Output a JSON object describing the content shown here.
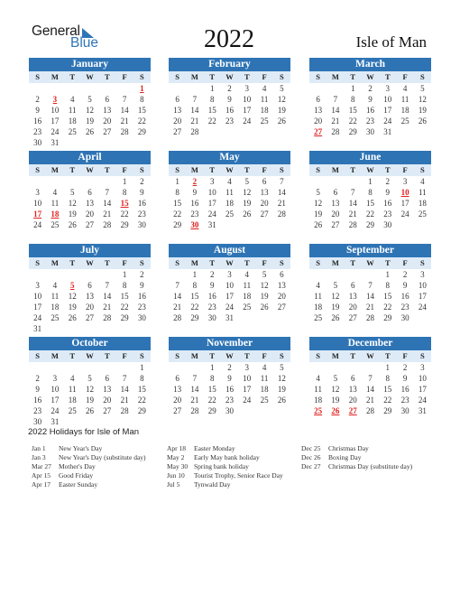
{
  "logo": {
    "line1": "General",
    "line2": "Blue"
  },
  "header": {
    "year": "2022",
    "region": "Isle of Man"
  },
  "weekday_labels": [
    "S",
    "M",
    "T",
    "W",
    "T",
    "F",
    "S"
  ],
  "colors": {
    "header_blue": "#2E74B5",
    "weekday_row": "#DEEBF7",
    "holiday_red": "#E0201E",
    "logo_blue": "#2E75B6"
  },
  "months": [
    {
      "name": "January",
      "holidays": [
        1,
        3
      ],
      "weeks": [
        [
          null,
          null,
          null,
          null,
          null,
          null,
          1
        ],
        [
          2,
          3,
          4,
          5,
          6,
          7,
          8
        ],
        [
          9,
          10,
          11,
          12,
          13,
          14,
          15
        ],
        [
          16,
          17,
          18,
          19,
          20,
          21,
          22
        ],
        [
          23,
          24,
          25,
          26,
          27,
          28,
          29
        ],
        [
          30,
          31,
          null,
          null,
          null,
          null,
          null
        ]
      ]
    },
    {
      "name": "February",
      "holidays": [],
      "weeks": [
        [
          null,
          null,
          1,
          2,
          3,
          4,
          5
        ],
        [
          6,
          7,
          8,
          9,
          10,
          11,
          12
        ],
        [
          13,
          14,
          15,
          16,
          17,
          18,
          19
        ],
        [
          20,
          21,
          22,
          23,
          24,
          25,
          26
        ],
        [
          27,
          28,
          null,
          null,
          null,
          null,
          null
        ]
      ]
    },
    {
      "name": "March",
      "holidays": [
        27
      ],
      "weeks": [
        [
          null,
          null,
          1,
          2,
          3,
          4,
          5
        ],
        [
          6,
          7,
          8,
          9,
          10,
          11,
          12
        ],
        [
          13,
          14,
          15,
          16,
          17,
          18,
          19
        ],
        [
          20,
          21,
          22,
          23,
          24,
          25,
          26
        ],
        [
          27,
          28,
          29,
          30,
          31,
          null,
          null
        ]
      ]
    },
    {
      "name": "April",
      "holidays": [
        15,
        17,
        18
      ],
      "weeks": [
        [
          null,
          null,
          null,
          null,
          null,
          1,
          2
        ],
        [
          3,
          4,
          5,
          6,
          7,
          8,
          9
        ],
        [
          10,
          11,
          12,
          13,
          14,
          15,
          16
        ],
        [
          17,
          18,
          19,
          20,
          21,
          22,
          23
        ],
        [
          24,
          25,
          26,
          27,
          28,
          29,
          30
        ]
      ]
    },
    {
      "name": "May",
      "holidays": [
        2,
        30
      ],
      "weeks": [
        [
          1,
          2,
          3,
          4,
          5,
          6,
          7
        ],
        [
          8,
          9,
          10,
          11,
          12,
          13,
          14
        ],
        [
          15,
          16,
          17,
          18,
          19,
          20,
          21
        ],
        [
          22,
          23,
          24,
          25,
          26,
          27,
          28
        ],
        [
          29,
          30,
          31,
          null,
          null,
          null,
          null
        ]
      ]
    },
    {
      "name": "June",
      "holidays": [
        10
      ],
      "weeks": [
        [
          null,
          null,
          null,
          1,
          2,
          3,
          4
        ],
        [
          5,
          6,
          7,
          8,
          9,
          10,
          11
        ],
        [
          12,
          13,
          14,
          15,
          16,
          17,
          18
        ],
        [
          19,
          20,
          21,
          22,
          23,
          24,
          25
        ],
        [
          26,
          27,
          28,
          29,
          30,
          null,
          null
        ]
      ]
    },
    {
      "name": "July",
      "holidays": [
        5
      ],
      "weeks": [
        [
          null,
          null,
          null,
          null,
          null,
          1,
          2
        ],
        [
          3,
          4,
          5,
          6,
          7,
          8,
          9
        ],
        [
          10,
          11,
          12,
          13,
          14,
          15,
          16
        ],
        [
          17,
          18,
          19,
          20,
          21,
          22,
          23
        ],
        [
          24,
          25,
          26,
          27,
          28,
          29,
          30
        ],
        [
          31,
          null,
          null,
          null,
          null,
          null,
          null
        ]
      ]
    },
    {
      "name": "August",
      "holidays": [],
      "weeks": [
        [
          null,
          1,
          2,
          3,
          4,
          5,
          6
        ],
        [
          7,
          8,
          9,
          10,
          11,
          12,
          13
        ],
        [
          14,
          15,
          16,
          17,
          18,
          19,
          20
        ],
        [
          21,
          22,
          23,
          24,
          25,
          26,
          27
        ],
        [
          28,
          29,
          30,
          31,
          null,
          null,
          null
        ]
      ]
    },
    {
      "name": "September",
      "holidays": [],
      "weeks": [
        [
          null,
          null,
          null,
          null,
          1,
          2,
          3
        ],
        [
          4,
          5,
          6,
          7,
          8,
          9,
          10
        ],
        [
          11,
          12,
          13,
          14,
          15,
          16,
          17
        ],
        [
          18,
          19,
          20,
          21,
          22,
          23,
          24
        ],
        [
          25,
          26,
          27,
          28,
          29,
          30,
          null
        ]
      ]
    },
    {
      "name": "October",
      "holidays": [],
      "weeks": [
        [
          null,
          null,
          null,
          null,
          null,
          null,
          1
        ],
        [
          2,
          3,
          4,
          5,
          6,
          7,
          8
        ],
        [
          9,
          10,
          11,
          12,
          13,
          14,
          15
        ],
        [
          16,
          17,
          18,
          19,
          20,
          21,
          22
        ],
        [
          23,
          24,
          25,
          26,
          27,
          28,
          29
        ],
        [
          30,
          31,
          null,
          null,
          null,
          null,
          null
        ]
      ]
    },
    {
      "name": "November",
      "holidays": [],
      "weeks": [
        [
          null,
          null,
          1,
          2,
          3,
          4,
          5
        ],
        [
          6,
          7,
          8,
          9,
          10,
          11,
          12
        ],
        [
          13,
          14,
          15,
          16,
          17,
          18,
          19
        ],
        [
          20,
          21,
          22,
          23,
          24,
          25,
          26
        ],
        [
          27,
          28,
          29,
          30,
          null,
          null,
          null
        ]
      ]
    },
    {
      "name": "December",
      "holidays": [
        25,
        26,
        27
      ],
      "weeks": [
        [
          null,
          null,
          null,
          null,
          1,
          2,
          3
        ],
        [
          4,
          5,
          6,
          7,
          8,
          9,
          10
        ],
        [
          11,
          12,
          13,
          14,
          15,
          16,
          17
        ],
        [
          18,
          19,
          20,
          21,
          22,
          23,
          24
        ],
        [
          25,
          26,
          27,
          28,
          29,
          30,
          31
        ]
      ]
    }
  ],
  "holidays_section": {
    "title": "2022 Holidays for Isle of Man",
    "columns": [
      [
        {
          "date": "Jan 1",
          "name": "New Year's Day"
        },
        {
          "date": "Jan 3",
          "name": "New Year's Day (substitute day)"
        },
        {
          "date": "Mar 27",
          "name": "Mother's Day"
        },
        {
          "date": "Apr 15",
          "name": "Good Friday"
        },
        {
          "date": "Apr 17",
          "name": "Easter Sunday"
        }
      ],
      [
        {
          "date": "Apr 18",
          "name": "Easter Monday"
        },
        {
          "date": "May 2",
          "name": "Early May bank holiday"
        },
        {
          "date": "May 30",
          "name": "Spring bank holiday"
        },
        {
          "date": "Jun 10",
          "name": "Tourist Trophy, Senior Race Day"
        },
        {
          "date": "Jul 5",
          "name": "Tynwald Day"
        }
      ],
      [
        {
          "date": "Dec 25",
          "name": "Christmas Day"
        },
        {
          "date": "Dec 26",
          "name": "Boxing Day"
        },
        {
          "date": "Dec 27",
          "name": "Christmas Day (substitute day)"
        }
      ]
    ]
  }
}
